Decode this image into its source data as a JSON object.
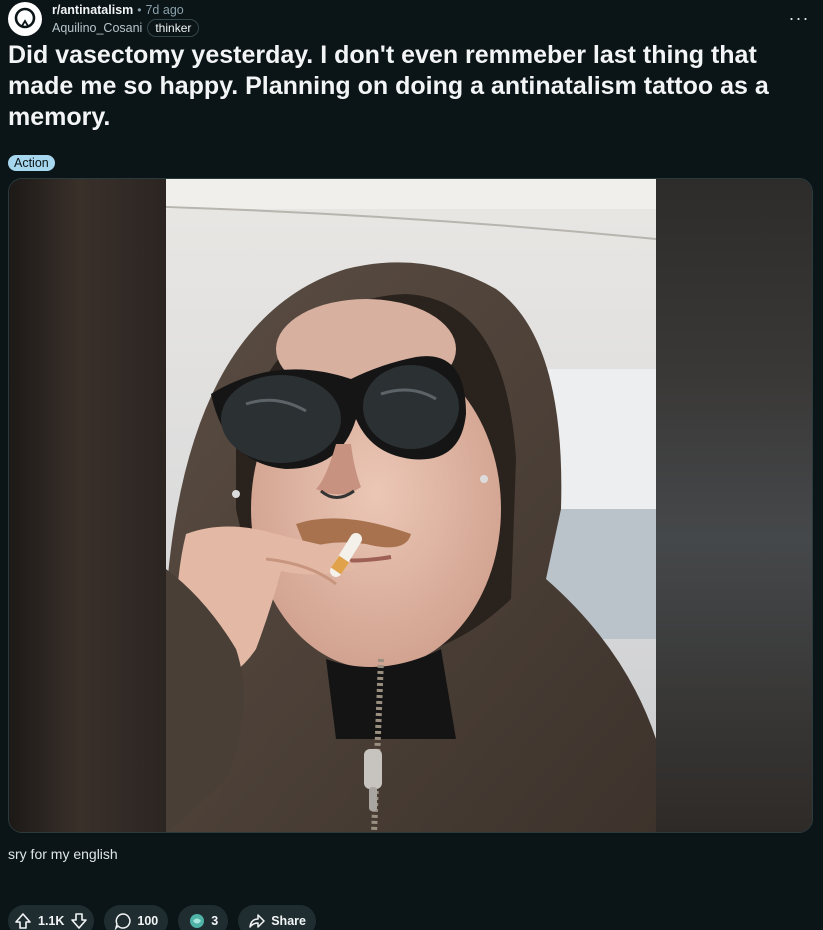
{
  "header": {
    "subreddit": "r/antinatalism",
    "separator": "•",
    "time": "7d ago",
    "author": "Aquilino_Cosani",
    "user_flair": "thinker",
    "more_label": "···"
  },
  "post": {
    "title": "Did vasectomy yesterday. I don't even remmeber last thing that made me so happy. Planning on doing a antinatalism tattoo as a memory.",
    "flair": "Action",
    "body": "sry for my english"
  },
  "actions": {
    "votes": "1.1K",
    "comments": "100",
    "awards": "3",
    "share": "Share"
  },
  "colors": {
    "background": "#0b1416",
    "pill": "#1f2d31",
    "post_flair": "#a6d7ee",
    "award": "#4fb3a8"
  },
  "icons": [
    "subreddit-avatar-icon",
    "more-options-icon",
    "upvote-icon",
    "downvote-icon",
    "comment-icon",
    "award-icon",
    "share-icon"
  ]
}
